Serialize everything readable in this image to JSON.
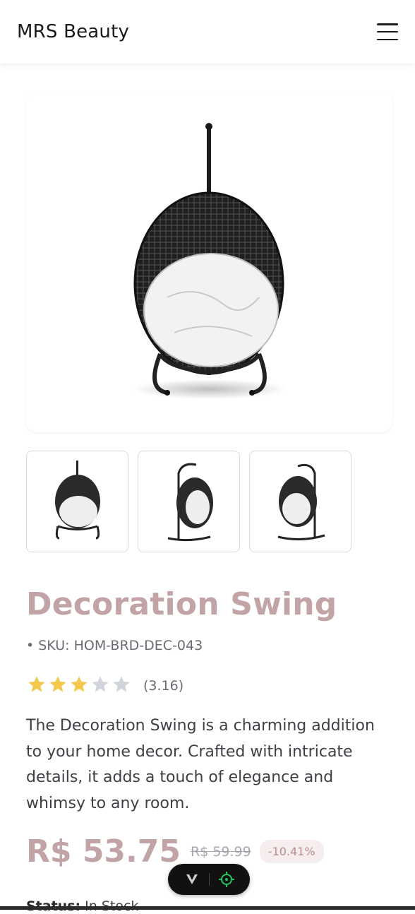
{
  "header": {
    "brand": "MRS Beauty",
    "menu_icon": "hamburger-menu-icon"
  },
  "gallery": {
    "main_image_alt": "Decoration Swing",
    "thumbnails": [
      {
        "alt": "Decoration Swing front view"
      },
      {
        "alt": "Decoration Swing side view"
      },
      {
        "alt": "Decoration Swing angle view"
      }
    ]
  },
  "product": {
    "title": "Decoration Swing",
    "sku": "• SKU: HOM-BRD-DEC-043",
    "rating": 3.16,
    "rating_text": "(3.16)",
    "stars_filled": 3,
    "stars_total": 5,
    "description": "The Decoration Swing is a charming addition to your home decor. Crafted with intricate details, it adds a touch of elegance and whimsy to any room.",
    "price": "R$ 53.75",
    "old_price": "R$ 59.99",
    "discount": "-10.41%",
    "stock_label": "Status:",
    "stock_value": "In Stock"
  },
  "toolbar": {
    "logo_icon": "vercel-v-icon",
    "target_icon": "crosshair-target-icon"
  },
  "colors": {
    "accent": "#c2a3a6",
    "star_filled": "#f2c94c",
    "star_empty": "#d1d5db",
    "target_green": "#22c55e"
  }
}
